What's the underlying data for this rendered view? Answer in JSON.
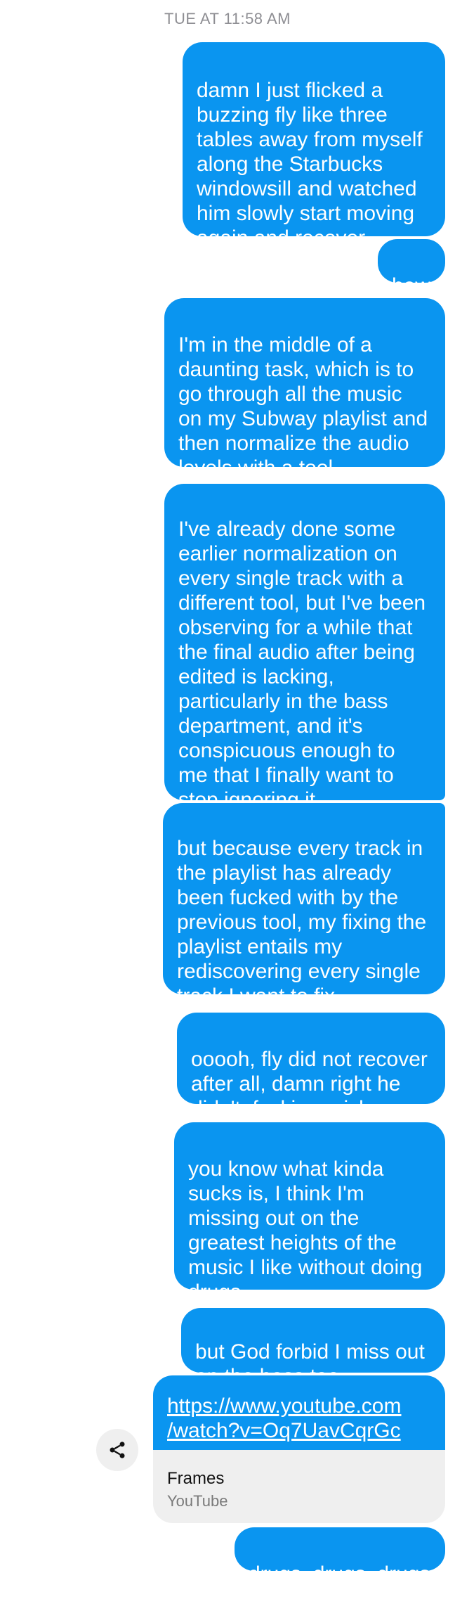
{
  "thread": {
    "timestamp": "TUE AT 11:58 AM"
  },
  "messages": [
    {
      "text": "damn I just flicked a\nbuzzing fly like three\ntables away from myself\nalong the Starbucks\nwindowsill and watched\nhim slowly start moving\nagain and recover"
    },
    {
      "text": "how"
    },
    {
      "text": "I'm in the middle of a\ndaunting task, which is to\ngo through all the music\non my Subway playlist and\nthen normalize the audio\nlevels with a tool"
    },
    {
      "text": "I've already done some\nearlier normalization on\nevery single track with a\ndifferent tool, but I've been\nobserving for a while that\nthe final audio after being\nedited is lacking,\nparticularly in the bass\ndepartment, and it's\nconspicuous enough to\nme that I finally want to\nstop ignoring it"
    },
    {
      "text": "but because every track in\nthe playlist has already\nbeen fucked with by the\nprevious tool, my fixing the\nplaylist entails my\nrediscovering every single\ntrack I want to fix"
    },
    {
      "text": "ooooh, fly did not recover\nafter all, damn right he\ndidn't, fucking prick"
    },
    {
      "text": "you know what kinda\nsucks is, I think I'm\nmissing out on the\ngreatest heights of the\nmusic I like without doing\ndrugs"
    },
    {
      "text": "but God forbid I miss out\non the bass too"
    },
    {
      "text": "drugs, drugs, drugs"
    }
  ],
  "link_preview": {
    "url": "https://www.youtube.com\n/watch?v=Oq7UavCqrGc",
    "title": "Frames",
    "source": "YouTube"
  },
  "share": {
    "icon": "share-icon"
  },
  "colors": {
    "bubble": "#0a95f0",
    "link_card_bg": "#efefef",
    "timestamp": "#8e8e93"
  }
}
